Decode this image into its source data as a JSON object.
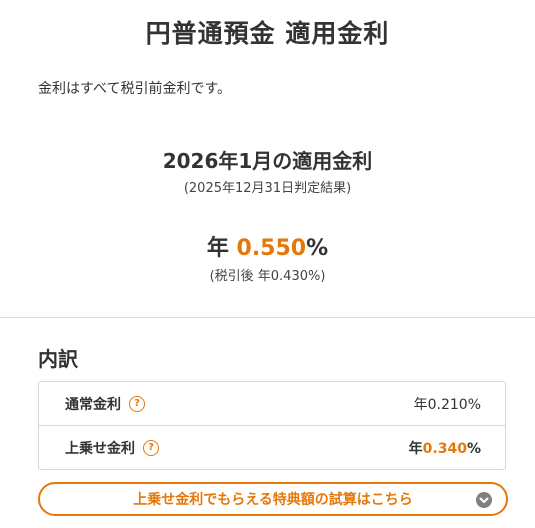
{
  "page_title": "円普通預金 適用金利",
  "note": "金利はすべて税引前金利です。",
  "month_heading": "2026年1月の適用金利",
  "judged_result": "(2025年12月31日判定結果)",
  "rate": {
    "prefix": "年",
    "value": "0.550",
    "suffix": "%",
    "after_tax": "(税引後 年0.430%)"
  },
  "breakdown": {
    "title": "内訳",
    "rows": [
      {
        "label": "通常金利",
        "value": "年0.210%"
      },
      {
        "label": "上乗せ金利",
        "prefix": "年",
        "value": "0.340",
        "suffix": "%"
      }
    ]
  },
  "help_icon_glyph": "?",
  "trial_button": {
    "label": "上乗せ金利でもらえる特典額の試算はこちら"
  },
  "colors": {
    "accent": "#e6780b",
    "text": "#333333",
    "border": "#d6d6d6",
    "chevron_bg": "#808080"
  },
  "icons": [
    "help-icon",
    "chevron-down-icon"
  ]
}
